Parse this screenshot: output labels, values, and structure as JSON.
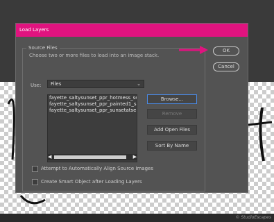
{
  "dialog": {
    "title": "Load Layers",
    "source_files": {
      "group_title": "Source Files",
      "description": "Choose two or more files to load into an image stack.",
      "use_label": "Use:",
      "use_value": "Files",
      "files": [
        "fayette_saltysunset_ppr_hotmess_sea.j",
        "fayette_saltysunset_ppr_painted1_suns",
        "fayette_saltysunset_ppr_sunsetatsea.jp"
      ],
      "buttons": {
        "browse": "Browse...",
        "remove": "Remove",
        "add_open_files": "Add Open Files",
        "sort_by_name": "Sort By Name"
      }
    },
    "checkboxes": {
      "align": "Attempt to Automatically Align Source Images",
      "smart_object": "Create Smart Object after Loading Layers"
    },
    "ok_label": "OK",
    "cancel_label": "Cancel"
  },
  "colors": {
    "titlebar": "#e0137f",
    "arrow": "#e0137f",
    "focus_border": "#4a8be8"
  }
}
